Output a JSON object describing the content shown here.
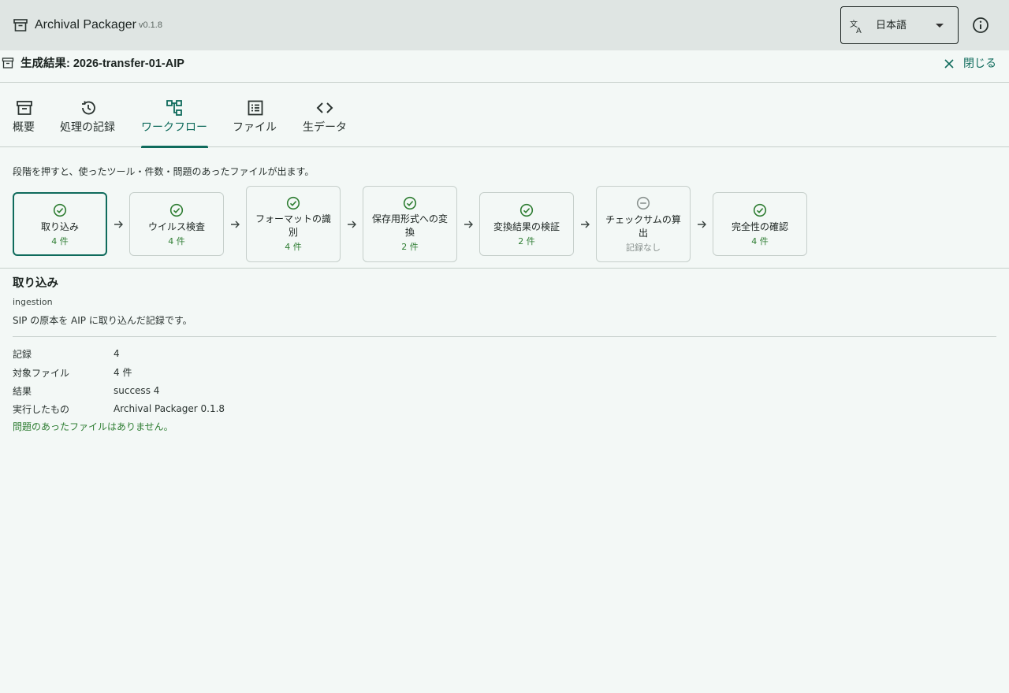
{
  "app": {
    "title": "Archival Packager",
    "version": "v0.1.8",
    "icon": "archive-icon"
  },
  "language": {
    "selected": "日本語",
    "icon": "translate-icon"
  },
  "header": {
    "title": "生成結果: 2026-transfer-01-AIP",
    "close_label": "閉じる"
  },
  "tabs": [
    {
      "label": "概要",
      "icon": "archive-icon"
    },
    {
      "label": "処理の記録",
      "icon": "history-icon"
    },
    {
      "label": "ワークフロー",
      "icon": "workflow-icon",
      "active": true
    },
    {
      "label": "ファイル",
      "icon": "list-icon"
    },
    {
      "label": "生データ",
      "icon": "code-icon"
    }
  ],
  "hint": "段階を押すと、使ったツール・件数・問題のあったファイルが出ます。",
  "steps": [
    {
      "name": "取り込み",
      "count": "4 件",
      "status": "success"
    },
    {
      "name": "ウイルス検査",
      "count": "4 件",
      "status": "success"
    },
    {
      "name_lines": [
        "フォーマットの識",
        "別"
      ],
      "count": "4 件",
      "status": "success"
    },
    {
      "name_lines": [
        "保存用形式への変",
        "換"
      ],
      "count": "2 件",
      "status": "success"
    },
    {
      "name": "変換結果の検証",
      "count": "2 件",
      "status": "success"
    },
    {
      "name_lines": [
        "チェックサムの算",
        "出"
      ],
      "count": "記録なし",
      "status": "none"
    },
    {
      "name": "完全性の確認",
      "count": "4 件",
      "status": "success"
    }
  ],
  "detail": {
    "title": "取り込み",
    "id": "ingestion",
    "description": "SIP の原本を AIP に取り込んだ記録です。",
    "rows": [
      {
        "label": "記録",
        "value": "4"
      },
      {
        "label": "対象ファイル",
        "value": "4 件"
      },
      {
        "label": "結果",
        "value": "success 4"
      },
      {
        "label": "実行したもの",
        "value": "Archival Packager 0.1.8"
      }
    ],
    "ok_message": "問題のあったファイルはありません。"
  },
  "colors": {
    "accent": "#0f6b5c",
    "success": "#2e7d32",
    "muted": "#8a928f",
    "appbar": "#dfe5e3",
    "background": "#f3f8f6"
  }
}
